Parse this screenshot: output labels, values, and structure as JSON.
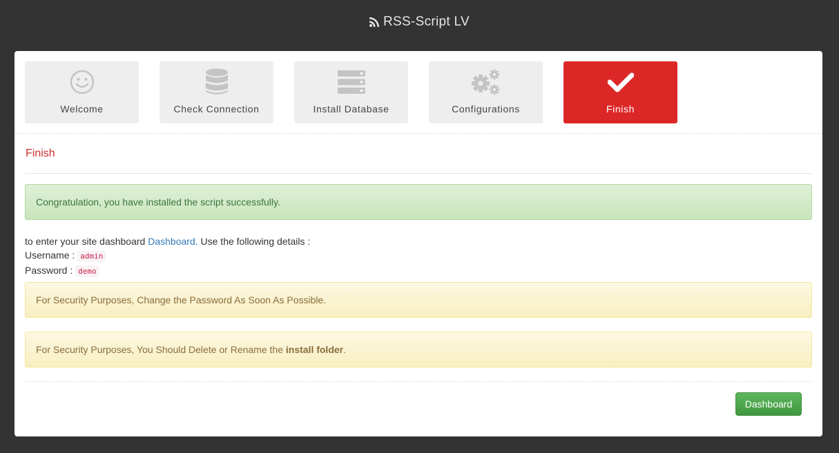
{
  "header": {
    "title": "RSS-Script LV",
    "icon": "rss-icon"
  },
  "steps": [
    {
      "label": "Welcome",
      "icon": "smiley-icon"
    },
    {
      "label": "Check Connection",
      "icon": "database-icon"
    },
    {
      "label": "Install Database",
      "icon": "server-icon"
    },
    {
      "label": "Configurations",
      "icon": "gears-icon"
    },
    {
      "label": "Finish",
      "icon": "checkmark-icon",
      "active": true
    }
  ],
  "section_title": "Finish",
  "alerts": {
    "success": "Congratulation, you have installed the script successfully.",
    "warning_password": "For Security Purposes, Change the Password As Soon As Possible.",
    "warning_folder_prefix": "For Security Purposes, You Should Delete or Rename the ",
    "warning_folder_bold": "install folder",
    "warning_folder_suffix": "."
  },
  "details": {
    "intro_prefix": "to enter your site dashboard ",
    "link": "Dashboard.",
    "intro_suffix": " Use the following details :",
    "username_label": "Username : ",
    "username": "admin",
    "password_label": "Password : ",
    "password": "demo"
  },
  "footer": {
    "button": "Dashboard"
  },
  "colors": {
    "active_step": "#dc2727",
    "success": "#dff0d8",
    "warning": "#fcf8e3",
    "button": "#5cb85c"
  }
}
